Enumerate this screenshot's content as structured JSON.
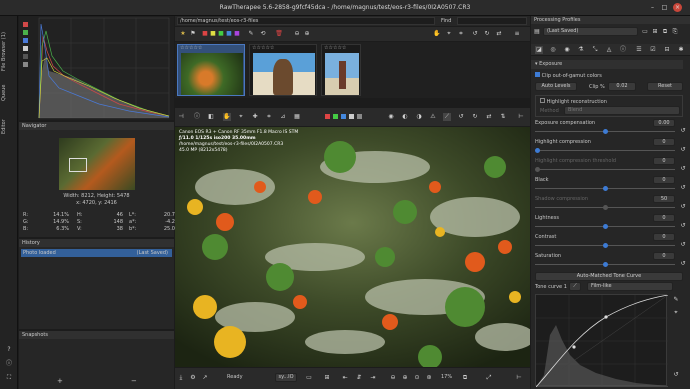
{
  "window": {
    "title": "RawTherapee 5.6-2858-g9fcf45dca - /home/magnus/test/eos-r3-files/0I2A0507.CR3"
  },
  "vtabs": [
    "File Browser (1)",
    "Queue",
    "Editor"
  ],
  "path_bar": {
    "path": "/home/magnus/test/eos-r3-files",
    "find_label": "Find"
  },
  "thumbs": [
    {
      "stars": "☆☆☆☆☆"
    },
    {
      "stars": "☆☆☆☆☆"
    },
    {
      "stars": "☆☆☆☆☆"
    }
  ],
  "navigator": {
    "title": "Navigator",
    "size": "Width: 8212, Height: 5478",
    "pos": "x: 4720, y: 2416",
    "rgb": [
      [
        "R:",
        "14.1%"
      ],
      [
        "G:",
        "14.9%"
      ],
      [
        "B:",
        "6.3%"
      ]
    ],
    "hsv": [
      [
        "H:",
        "46"
      ],
      [
        "S:",
        "148"
      ],
      [
        "V:",
        "38"
      ]
    ],
    "lab": [
      [
        "L*:",
        "20.7"
      ],
      [
        "a*:",
        "-4.2"
      ],
      [
        "b*:",
        "25.0"
      ]
    ]
  },
  "history": {
    "title": "History",
    "item": "Photo loaded",
    "item_right": "(Last Saved)"
  },
  "snapshots": {
    "title": "Snapshots",
    "add": "+",
    "remove": "−"
  },
  "image_info": {
    "line1": "Canon EOS R3 + Canon RF 35mm F1.8 Macro IS STM",
    "line2": "ƒ/11.0 1/125s iso200 35.00mm",
    "line3": "/home/magnus/test/eos-r3-files/0I2A0507.CR3",
    "line4": "45.0 MP (8212x5478)"
  },
  "statusbar": {
    "ready": "Ready",
    "zoom": "17%",
    "profile": "sy...IO"
  },
  "profiles": {
    "header": "Processing Profiles",
    "value": "(Last Saved)"
  },
  "exposure": {
    "section": "Exposure",
    "clip_label": "Clip out-of-gamut colors",
    "auto_levels": "Auto Levels",
    "clip_pct_label": "Clip %",
    "clip_pct": "0.02",
    "reset": "Reset",
    "highlight_recon": "Highlight reconstruction",
    "method_label": "Method",
    "method_value": "Blend",
    "params": [
      {
        "label": "Exposure compensation",
        "value": "0.00",
        "pos": 0.5,
        "dim": false
      },
      {
        "label": "Highlight compression",
        "value": "0",
        "pos": 0.0,
        "dim": false
      },
      {
        "label": "Highlight compression threshold",
        "value": "0",
        "pos": 0.0,
        "dim": true
      },
      {
        "label": "Black",
        "value": "0",
        "pos": 0.5,
        "dim": false
      },
      {
        "label": "Shadow compression",
        "value": "50",
        "pos": 0.5,
        "dim": true
      },
      {
        "label": "Lightness",
        "value": "0",
        "pos": 0.5,
        "dim": false
      },
      {
        "label": "Contrast",
        "value": "0",
        "pos": 0.5,
        "dim": false
      },
      {
        "label": "Saturation",
        "value": "0",
        "pos": 0.5,
        "dim": false
      }
    ],
    "auto_tone": "Auto-Matched Tone Curve",
    "tone_curve_label": "Tone curve 1",
    "tone_curve_mode": "Film-like"
  },
  "colors": {
    "accent": "#3d7bd4",
    "selection": "#33609a",
    "bg": "#1c1c1c"
  }
}
